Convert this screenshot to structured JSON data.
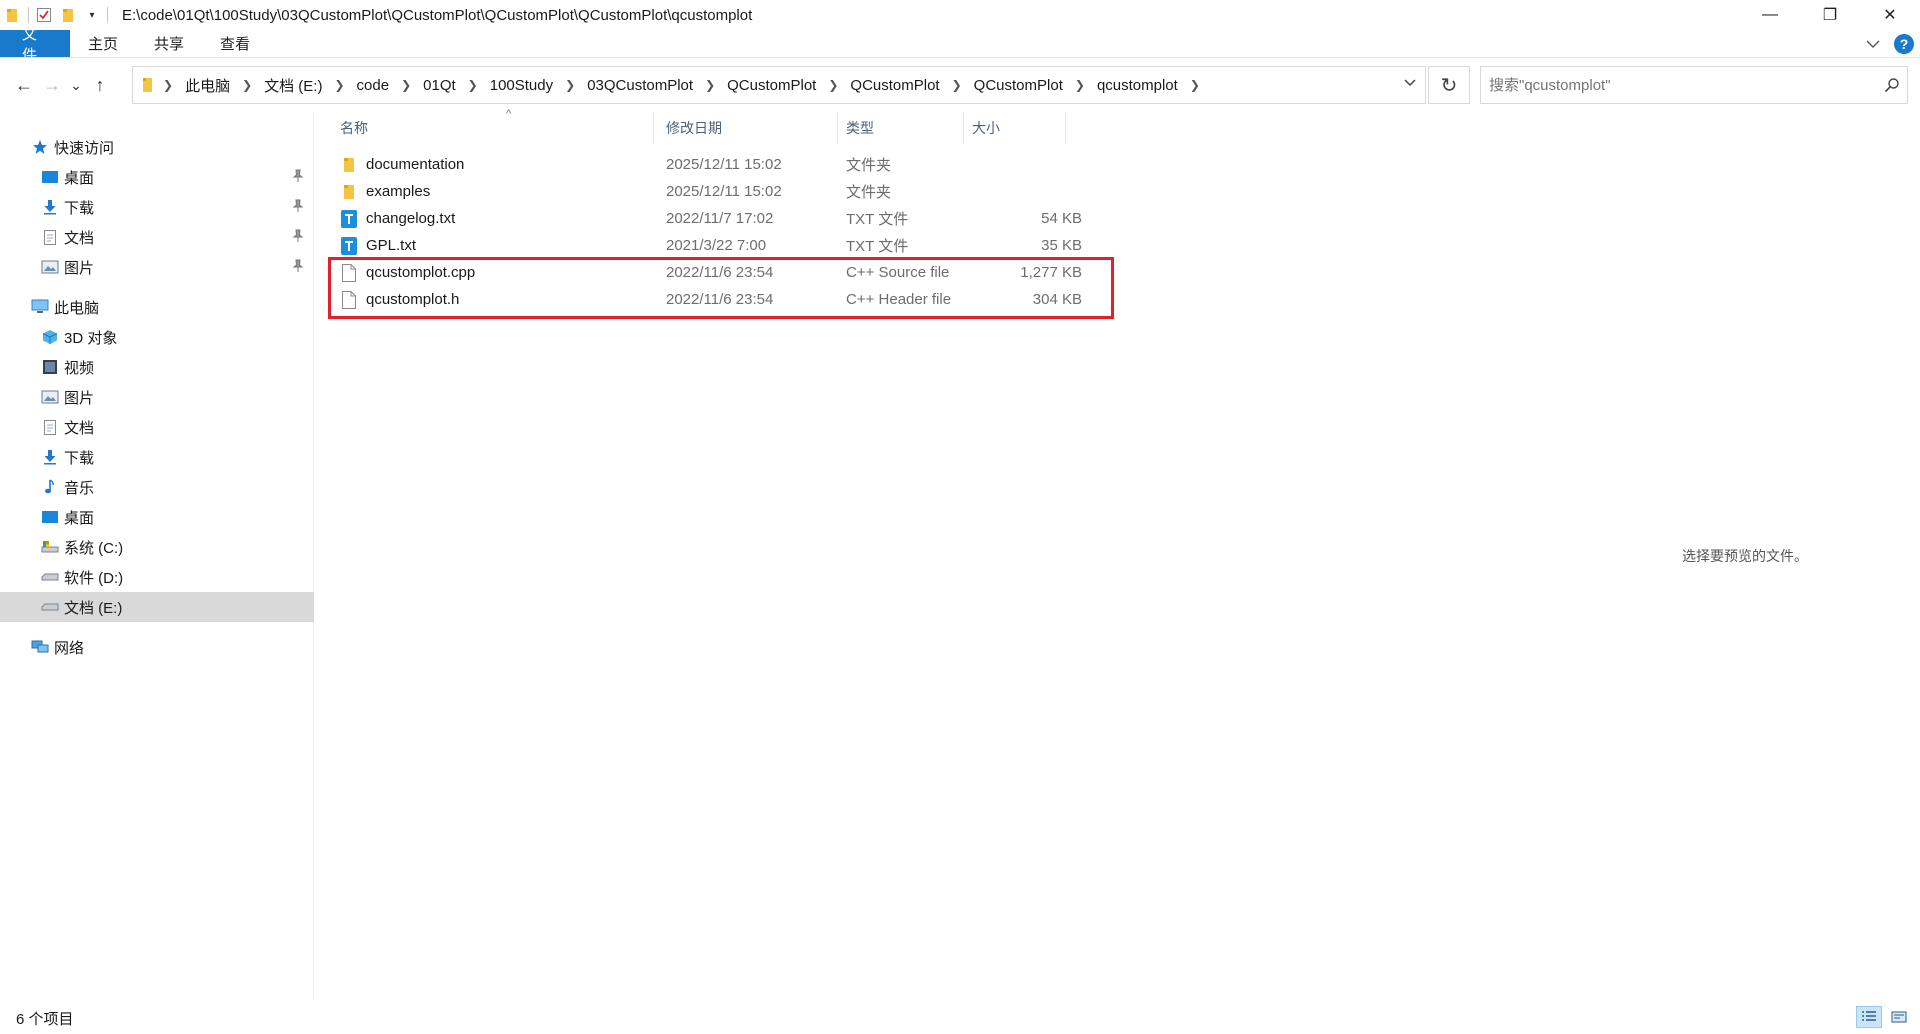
{
  "titlebar": {
    "path": "E:\\code\\01Qt\\100Study\\03QCustomPlot\\QCustomPlot\\QCustomPlot\\QCustomPlot\\qcustomplot",
    "minimize": "—",
    "maximize": "❐",
    "close": "✕"
  },
  "ribbon": {
    "tabs": [
      "文件",
      "主页",
      "共享",
      "查看"
    ],
    "help": "?"
  },
  "nav": {
    "back": "←",
    "forward": "→",
    "recent": "⌄",
    "up": "↑",
    "breadcrumbs": [
      "此电脑",
      "文档 (E:)",
      "code",
      "01Qt",
      "100Study",
      "03QCustomPlot",
      "QCustomPlot",
      "QCustomPlot",
      "QCustomPlot",
      "qcustomplot"
    ],
    "refresh": "↻",
    "search_placeholder": "搜索\"qcustomplot\""
  },
  "sidebar": {
    "quick_access": "快速访问",
    "quick_items": [
      "桌面",
      "下载",
      "文档",
      "图片"
    ],
    "this_pc": "此电脑",
    "pc_items": [
      "3D 对象",
      "视频",
      "图片",
      "文档",
      "下载",
      "音乐",
      "桌面",
      "系统 (C:)",
      "软件 (D:)",
      "文档 (E:)"
    ],
    "network": "网络"
  },
  "columns": {
    "name": "名称",
    "date": "修改日期",
    "type": "类型",
    "size": "大小"
  },
  "files": [
    {
      "name": "documentation",
      "date": "2025/12/11 15:02",
      "type": "文件夹",
      "size": "",
      "icon": "folder-icon"
    },
    {
      "name": "examples",
      "date": "2025/12/11 15:02",
      "type": "文件夹",
      "size": "",
      "icon": "folder-icon"
    },
    {
      "name": "changelog.txt",
      "date": "2022/11/7 17:02",
      "type": "TXT 文件",
      "size": "54 KB",
      "icon": "text-file-icon"
    },
    {
      "name": "GPL.txt",
      "date": "2021/3/22 7:00",
      "type": "TXT 文件",
      "size": "35 KB",
      "icon": "text-file-icon"
    },
    {
      "name": "qcustomplot.cpp",
      "date": "2022/11/6 23:54",
      "type": "C++ Source file",
      "size": "1,277 KB",
      "icon": "blank-file-icon"
    },
    {
      "name": "qcustomplot.h",
      "date": "2022/11/6 23:54",
      "type": "C++ Header file",
      "size": "304 KB",
      "icon": "blank-file-icon"
    }
  ],
  "preview": {
    "message": "选择要预览的文件。"
  },
  "status": {
    "count": "6 个项目"
  },
  "colors": {
    "accent": "#1979ca",
    "highlight_box": "#e0202a",
    "selected_bg": "#d9d9d9"
  }
}
